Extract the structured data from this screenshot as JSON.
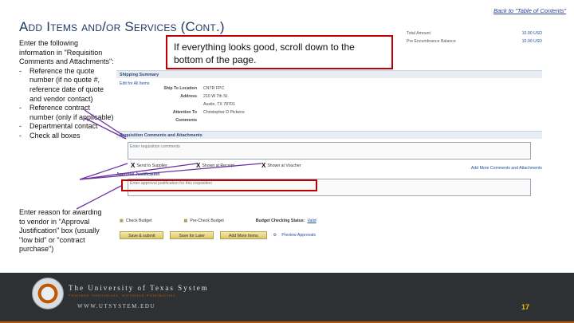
{
  "nav": {
    "back_link": "Back to \"Table of Contents\""
  },
  "slide": {
    "title": "Add Items and/or Services (Cont.)"
  },
  "instructions": {
    "intro": "Enter the following information in \"Requisition Comments and Attachments\":",
    "items": [
      "Reference the quote number (if no quote #, reference date of quote and vendor contact)",
      "Reference contract number (only if applicable)",
      "Departmental contact",
      "Check all boxes"
    ]
  },
  "reason_note": "Enter reason for awarding to vendor in \"Approval Justification\" box (usually \"low bid\" or \"contract purchase\")",
  "callout": "If everything looks good, scroll down to the bottom of the page.",
  "screenshot": {
    "totals": [
      {
        "label": "Total Amount",
        "value": "10.00 USD"
      },
      {
        "label": "Pre Encumbrance Balance",
        "value": "10.00 USD"
      }
    ],
    "shipping_header": "Shipping Summary",
    "edit_link": "Edit for All Items",
    "shipping_rows": [
      {
        "label": "Ship To Location",
        "value": "CNTR FPC"
      },
      {
        "label": "Address",
        "value": "210 W 7th St."
      },
      {
        "label": "",
        "value": "Austin, TX 78701"
      },
      {
        "label": "Attention To",
        "value": "Christopher D Pickens"
      },
      {
        "label": "Comments",
        "value": ""
      }
    ],
    "comments_header": "Requisition Comments and Attachments",
    "comment_placeholder": "Enter requisition comments",
    "checkboxes": [
      {
        "mark": "X",
        "label": "Send to Supplier"
      },
      {
        "mark": "X",
        "label": "Shown at Receipt"
      },
      {
        "mark": "X",
        "label": "Shown at Voucher"
      }
    ],
    "add_comments_link": "Add More Comments and Attachments",
    "approval_label": "Approval Justification",
    "approval_placeholder": "Enter approval justification for this requisition",
    "check_budget": "Check Budget",
    "precheck_budget": "Pre-Check Budget",
    "budget_status_label": "Budget Checking Status:",
    "budget_status_value": "Valid",
    "buttons": {
      "save_submit": "Save & submit",
      "save_later": "Save for Later",
      "add_items": "Add More Items"
    },
    "preview_link": "Preview Approvals"
  },
  "footer": {
    "institution": "The University of Texas System",
    "tagline": "Fourteen Institutions. Unlimited Possibilities.",
    "url": "WWW.UTSYSTEM.EDU",
    "page_number": "17"
  },
  "colors": {
    "highlight": "#c00000",
    "footer_bg": "#2e3134",
    "accent": "#bf5700",
    "title": "#1f3864"
  }
}
